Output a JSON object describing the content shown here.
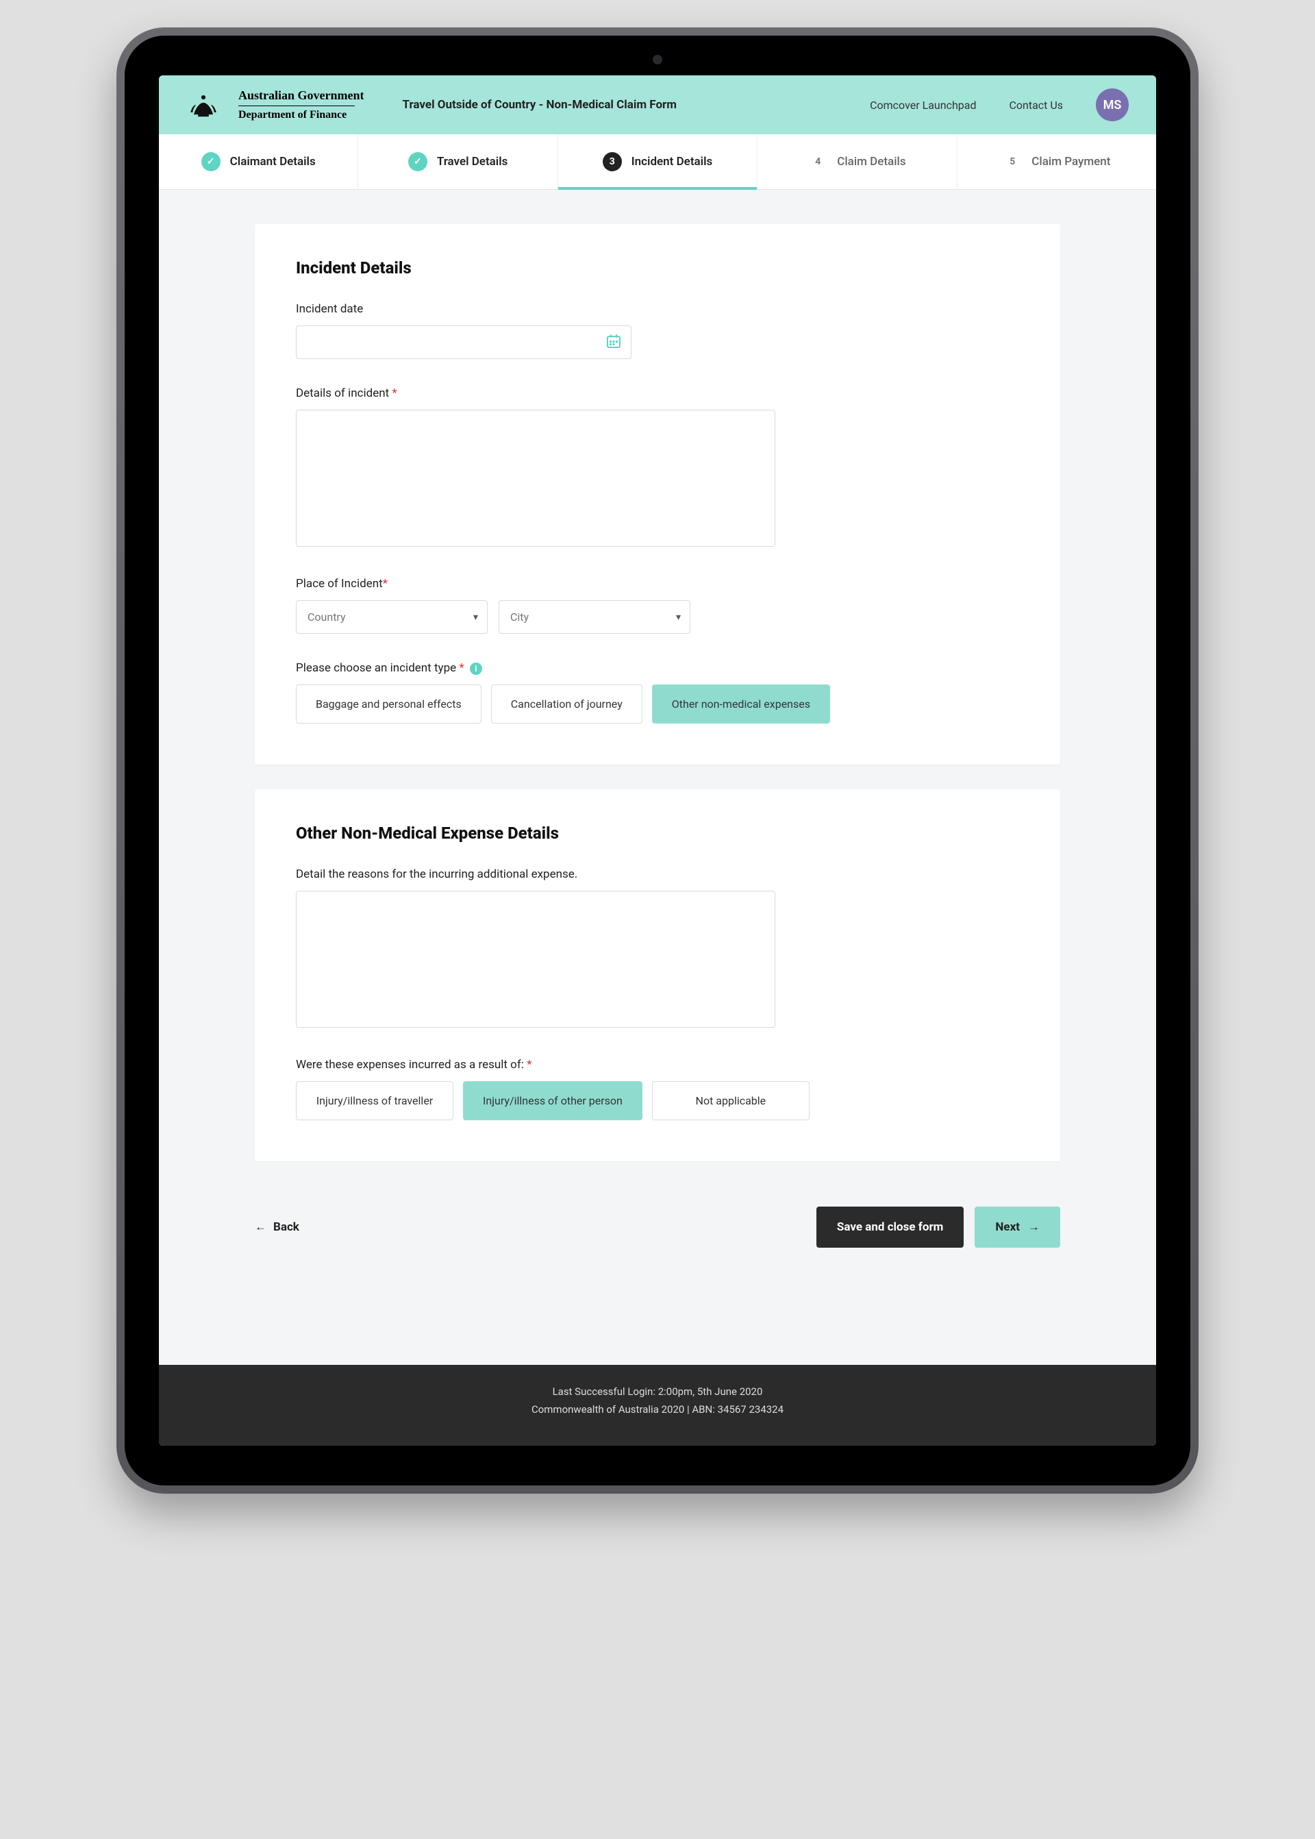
{
  "header": {
    "gov_line1": "Australian Government",
    "gov_line2": "Department of Finance",
    "form_title": "Travel Outside of Country - Non-Medical Claim Form",
    "link_launchpad": "Comcover Launchpad",
    "link_contact": "Contact Us",
    "avatar_initials": "MS"
  },
  "steps": [
    {
      "num": "✓",
      "label": "Claimant Details",
      "state": "done"
    },
    {
      "num": "✓",
      "label": "Travel Details",
      "state": "done"
    },
    {
      "num": "3",
      "label": "Incident Details",
      "state": "current"
    },
    {
      "num": "4",
      "label": "Claim Details",
      "state": "future"
    },
    {
      "num": "5",
      "label": "Claim Payment",
      "state": "future"
    }
  ],
  "section1": {
    "title": "Incident Details",
    "incident_date_label": "Incident date",
    "details_label": "Details of incident ",
    "place_label": "Place of Incident",
    "country_placeholder": "Country",
    "city_placeholder": "City",
    "type_label": "Please choose an incident type ",
    "type_options": [
      {
        "label": "Baggage and personal effects",
        "selected": false
      },
      {
        "label": "Cancellation of journey",
        "selected": false
      },
      {
        "label": "Other non-medical expenses",
        "selected": true
      }
    ]
  },
  "section2": {
    "title": "Other Non-Medical Expense Details",
    "detail_label": "Detail the reasons for the incurring additional expense.",
    "result_label": "Were these expenses incurred as a result of: ",
    "result_options": [
      {
        "label": "Injury/illness of traveller",
        "selected": false
      },
      {
        "label": "Injury/illness of other person",
        "selected": true
      },
      {
        "label": "Not applicable",
        "selected": false
      }
    ]
  },
  "actions": {
    "back": "Back",
    "save": "Save and close form",
    "next": "Next"
  },
  "footer": {
    "line1": "Last Successful Login: 2:00pm, 5th June 2020",
    "line2": "Commonwealth of Australia 2020 |  ABN: 34567 234324"
  }
}
